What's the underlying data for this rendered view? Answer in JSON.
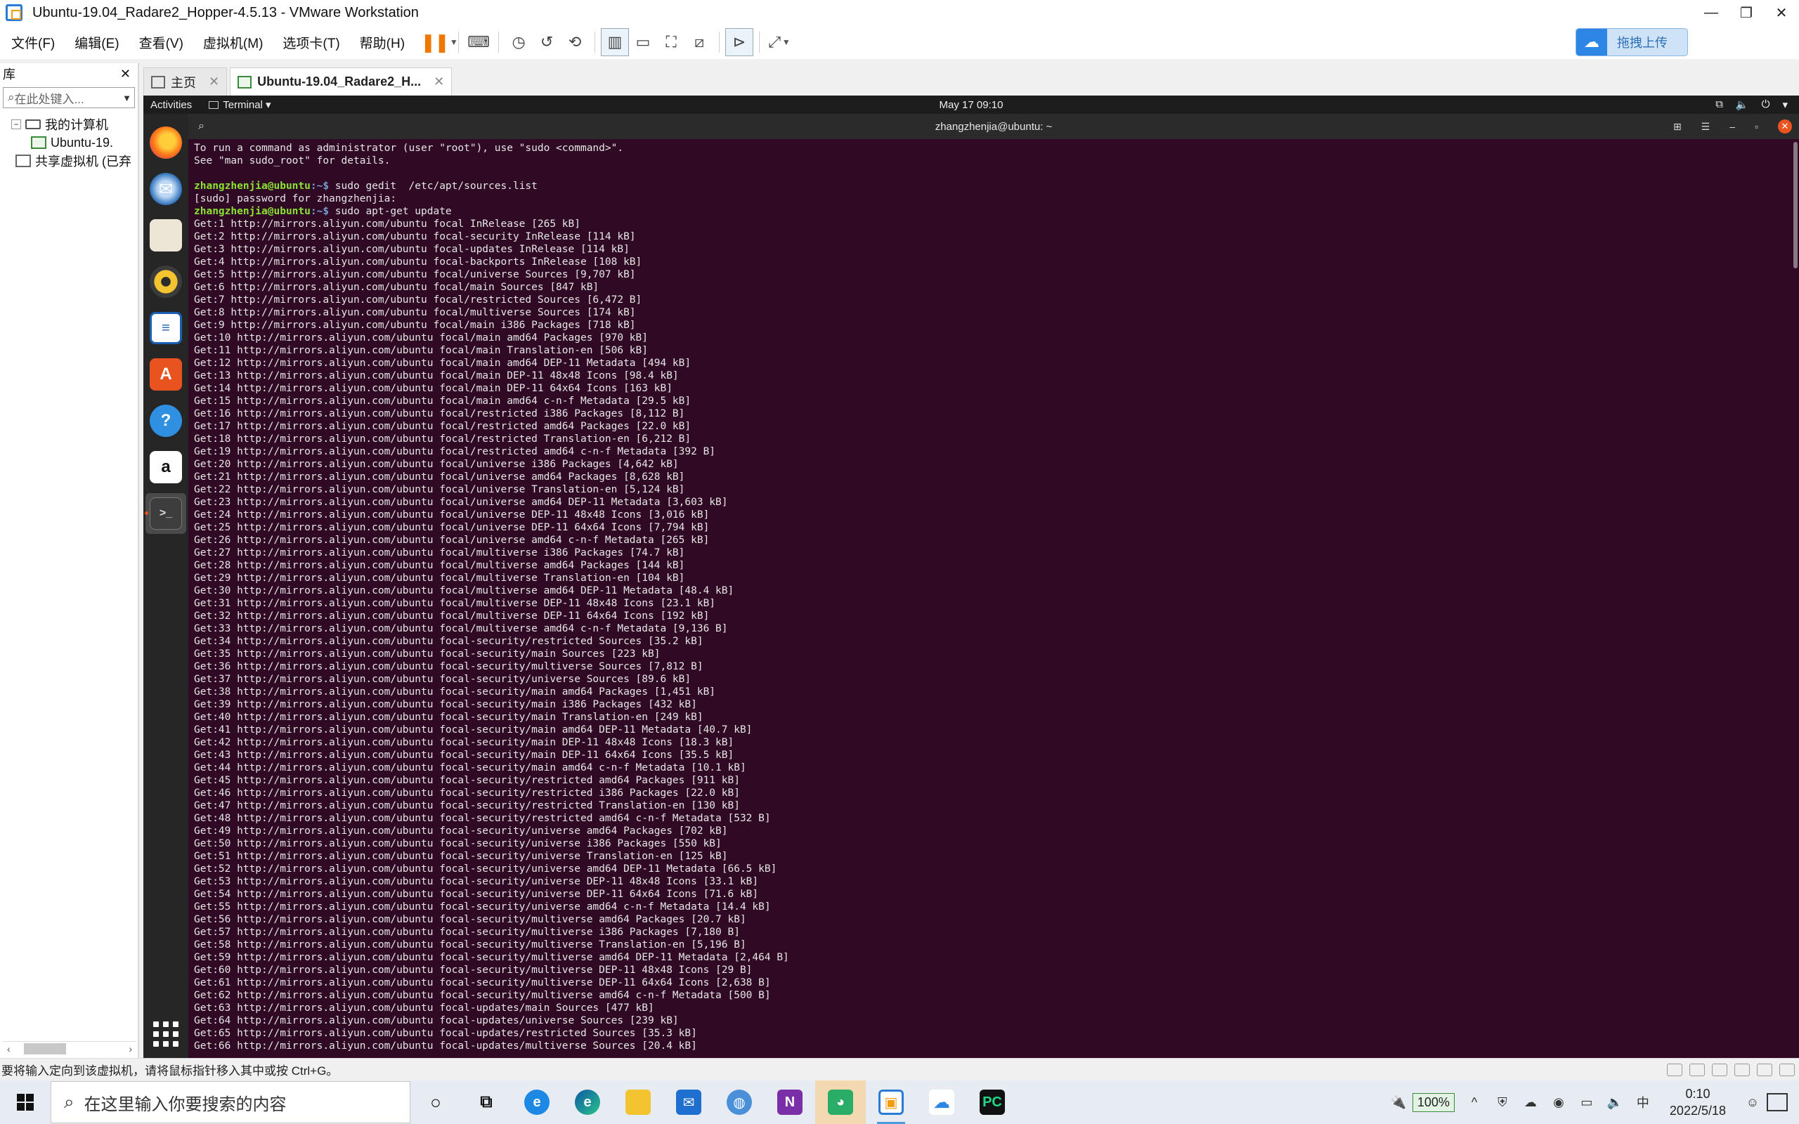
{
  "window": {
    "title": "Ubuntu-19.04_Radare2_Hopper-4.5.13 - VMware Workstation",
    "controls": [
      "—",
      "❐",
      "✕"
    ]
  },
  "menu": [
    "文件(F)",
    "编辑(E)",
    "查看(V)",
    "虚拟机(M)",
    "选项卡(T)",
    "帮助(H)"
  ],
  "upload_button": "拖拽上传",
  "library": {
    "title": "库",
    "close": "✕",
    "search_placeholder": "在此处键入...",
    "tree": [
      "我的计算机",
      "Ubuntu-19.",
      "共享虚拟机 (已弃"
    ]
  },
  "tabs": [
    {
      "label": "主页",
      "close": "✕"
    },
    {
      "label": "Ubuntu-19.04_Radare2_H...",
      "close": "✕"
    }
  ],
  "ubuntu": {
    "activities": "Activities",
    "app_menu": "Terminal ▾",
    "clock": "May 17  09:10",
    "terminal_title": "zhangzhenjia@ubuntu: ~"
  },
  "terminal": {
    "intro": [
      "To run a command as administrator (user \"root\"), use \"sudo <command>\".",
      "See \"man sudo_root\" for details.",
      ""
    ],
    "prompt_user": "zhangzhenjia@ubuntu",
    "prompt_path": ":~$ ",
    "cmd1": "sudo gedit  /etc/apt/sources.list",
    "sudo_line": "[sudo] password for zhangzhenjia:",
    "cmd2": "sudo apt-get update",
    "output": [
      "Get:1 http://mirrors.aliyun.com/ubuntu focal InRelease [265 kB]",
      "Get:2 http://mirrors.aliyun.com/ubuntu focal-security InRelease [114 kB]",
      "Get:3 http://mirrors.aliyun.com/ubuntu focal-updates InRelease [114 kB]",
      "Get:4 http://mirrors.aliyun.com/ubuntu focal-backports InRelease [108 kB]",
      "Get:5 http://mirrors.aliyun.com/ubuntu focal/universe Sources [9,707 kB]",
      "Get:6 http://mirrors.aliyun.com/ubuntu focal/main Sources [847 kB]",
      "Get:7 http://mirrors.aliyun.com/ubuntu focal/restricted Sources [6,472 B]",
      "Get:8 http://mirrors.aliyun.com/ubuntu focal/multiverse Sources [174 kB]",
      "Get:9 http://mirrors.aliyun.com/ubuntu focal/main i386 Packages [718 kB]",
      "Get:10 http://mirrors.aliyun.com/ubuntu focal/main amd64 Packages [970 kB]",
      "Get:11 http://mirrors.aliyun.com/ubuntu focal/main Translation-en [506 kB]",
      "Get:12 http://mirrors.aliyun.com/ubuntu focal/main amd64 DEP-11 Metadata [494 kB]",
      "Get:13 http://mirrors.aliyun.com/ubuntu focal/main DEP-11 48x48 Icons [98.4 kB]",
      "Get:14 http://mirrors.aliyun.com/ubuntu focal/main DEP-11 64x64 Icons [163 kB]",
      "Get:15 http://mirrors.aliyun.com/ubuntu focal/main amd64 c-n-f Metadata [29.5 kB]",
      "Get:16 http://mirrors.aliyun.com/ubuntu focal/restricted i386 Packages [8,112 B]",
      "Get:17 http://mirrors.aliyun.com/ubuntu focal/restricted amd64 Packages [22.0 kB]",
      "Get:18 http://mirrors.aliyun.com/ubuntu focal/restricted Translation-en [6,212 B]",
      "Get:19 http://mirrors.aliyun.com/ubuntu focal/restricted amd64 c-n-f Metadata [392 B]",
      "Get:20 http://mirrors.aliyun.com/ubuntu focal/universe i386 Packages [4,642 kB]",
      "Get:21 http://mirrors.aliyun.com/ubuntu focal/universe amd64 Packages [8,628 kB]",
      "Get:22 http://mirrors.aliyun.com/ubuntu focal/universe Translation-en [5,124 kB]",
      "Get:23 http://mirrors.aliyun.com/ubuntu focal/universe amd64 DEP-11 Metadata [3,603 kB]",
      "Get:24 http://mirrors.aliyun.com/ubuntu focal/universe DEP-11 48x48 Icons [3,016 kB]",
      "Get:25 http://mirrors.aliyun.com/ubuntu focal/universe DEP-11 64x64 Icons [7,794 kB]",
      "Get:26 http://mirrors.aliyun.com/ubuntu focal/universe amd64 c-n-f Metadata [265 kB]",
      "Get:27 http://mirrors.aliyun.com/ubuntu focal/multiverse i386 Packages [74.7 kB]",
      "Get:28 http://mirrors.aliyun.com/ubuntu focal/multiverse amd64 Packages [144 kB]",
      "Get:29 http://mirrors.aliyun.com/ubuntu focal/multiverse Translation-en [104 kB]",
      "Get:30 http://mirrors.aliyun.com/ubuntu focal/multiverse amd64 DEP-11 Metadata [48.4 kB]",
      "Get:31 http://mirrors.aliyun.com/ubuntu focal/multiverse DEP-11 48x48 Icons [23.1 kB]",
      "Get:32 http://mirrors.aliyun.com/ubuntu focal/multiverse DEP-11 64x64 Icons [192 kB]",
      "Get:33 http://mirrors.aliyun.com/ubuntu focal/multiverse amd64 c-n-f Metadata [9,136 B]",
      "Get:34 http://mirrors.aliyun.com/ubuntu focal-security/restricted Sources [35.2 kB]",
      "Get:35 http://mirrors.aliyun.com/ubuntu focal-security/main Sources [223 kB]",
      "Get:36 http://mirrors.aliyun.com/ubuntu focal-security/multiverse Sources [7,812 B]",
      "Get:37 http://mirrors.aliyun.com/ubuntu focal-security/universe Sources [89.6 kB]",
      "Get:38 http://mirrors.aliyun.com/ubuntu focal-security/main amd64 Packages [1,451 kB]",
      "Get:39 http://mirrors.aliyun.com/ubuntu focal-security/main i386 Packages [432 kB]",
      "Get:40 http://mirrors.aliyun.com/ubuntu focal-security/main Translation-en [249 kB]",
      "Get:41 http://mirrors.aliyun.com/ubuntu focal-security/main amd64 DEP-11 Metadata [40.7 kB]",
      "Get:42 http://mirrors.aliyun.com/ubuntu focal-security/main DEP-11 48x48 Icons [18.3 kB]",
      "Get:43 http://mirrors.aliyun.com/ubuntu focal-security/main DEP-11 64x64 Icons [35.5 kB]",
      "Get:44 http://mirrors.aliyun.com/ubuntu focal-security/main amd64 c-n-f Metadata [10.1 kB]",
      "Get:45 http://mirrors.aliyun.com/ubuntu focal-security/restricted amd64 Packages [911 kB]",
      "Get:46 http://mirrors.aliyun.com/ubuntu focal-security/restricted i386 Packages [22.0 kB]",
      "Get:47 http://mirrors.aliyun.com/ubuntu focal-security/restricted Translation-en [130 kB]",
      "Get:48 http://mirrors.aliyun.com/ubuntu focal-security/restricted amd64 c-n-f Metadata [532 B]",
      "Get:49 http://mirrors.aliyun.com/ubuntu focal-security/universe amd64 Packages [702 kB]",
      "Get:50 http://mirrors.aliyun.com/ubuntu focal-security/universe i386 Packages [550 kB]",
      "Get:51 http://mirrors.aliyun.com/ubuntu focal-security/universe Translation-en [125 kB]",
      "Get:52 http://mirrors.aliyun.com/ubuntu focal-security/universe amd64 DEP-11 Metadata [66.5 kB]",
      "Get:53 http://mirrors.aliyun.com/ubuntu focal-security/universe DEP-11 48x48 Icons [33.1 kB]",
      "Get:54 http://mirrors.aliyun.com/ubuntu focal-security/universe DEP-11 64x64 Icons [71.6 kB]",
      "Get:55 http://mirrors.aliyun.com/ubuntu focal-security/universe amd64 c-n-f Metadata [14.4 kB]",
      "Get:56 http://mirrors.aliyun.com/ubuntu focal-security/multiverse amd64 Packages [20.7 kB]",
      "Get:57 http://mirrors.aliyun.com/ubuntu focal-security/multiverse i386 Packages [7,180 B]",
      "Get:58 http://mirrors.aliyun.com/ubuntu focal-security/multiverse Translation-en [5,196 B]",
      "Get:59 http://mirrors.aliyun.com/ubuntu focal-security/multiverse amd64 DEP-11 Metadata [2,464 B]",
      "Get:60 http://mirrors.aliyun.com/ubuntu focal-security/multiverse DEP-11 48x48 Icons [29 B]",
      "Get:61 http://mirrors.aliyun.com/ubuntu focal-security/multiverse DEP-11 64x64 Icons [2,638 B]",
      "Get:62 http://mirrors.aliyun.com/ubuntu focal-security/multiverse amd64 c-n-f Metadata [500 B]",
      "Get:63 http://mirrors.aliyun.com/ubuntu focal-updates/main Sources [477 kB]",
      "Get:64 http://mirrors.aliyun.com/ubuntu focal-updates/universe Sources [239 kB]",
      "Get:65 http://mirrors.aliyun.com/ubuntu focal-updates/restricted Sources [35.3 kB]",
      "Get:66 http://mirrors.aliyun.com/ubuntu focal-updates/multiverse Sources [20.4 kB]"
    ]
  },
  "statusbar": {
    "message": "要将输入定向到该虚拟机，请将鼠标指针移入其中或按 Ctrl+G。"
  },
  "taskbar": {
    "search_placeholder": "在这里输入你要搜索的内容",
    "battery": "100%",
    "ime": "中",
    "time": "0:10",
    "date": "2022/5/18"
  },
  "colors": {
    "terminal_bg": "#300a24",
    "prompt_user": "#8ae234",
    "prompt_path": "#729fcf",
    "ubuntu_accent": "#e95420",
    "vmware_pause": "#f07800"
  }
}
